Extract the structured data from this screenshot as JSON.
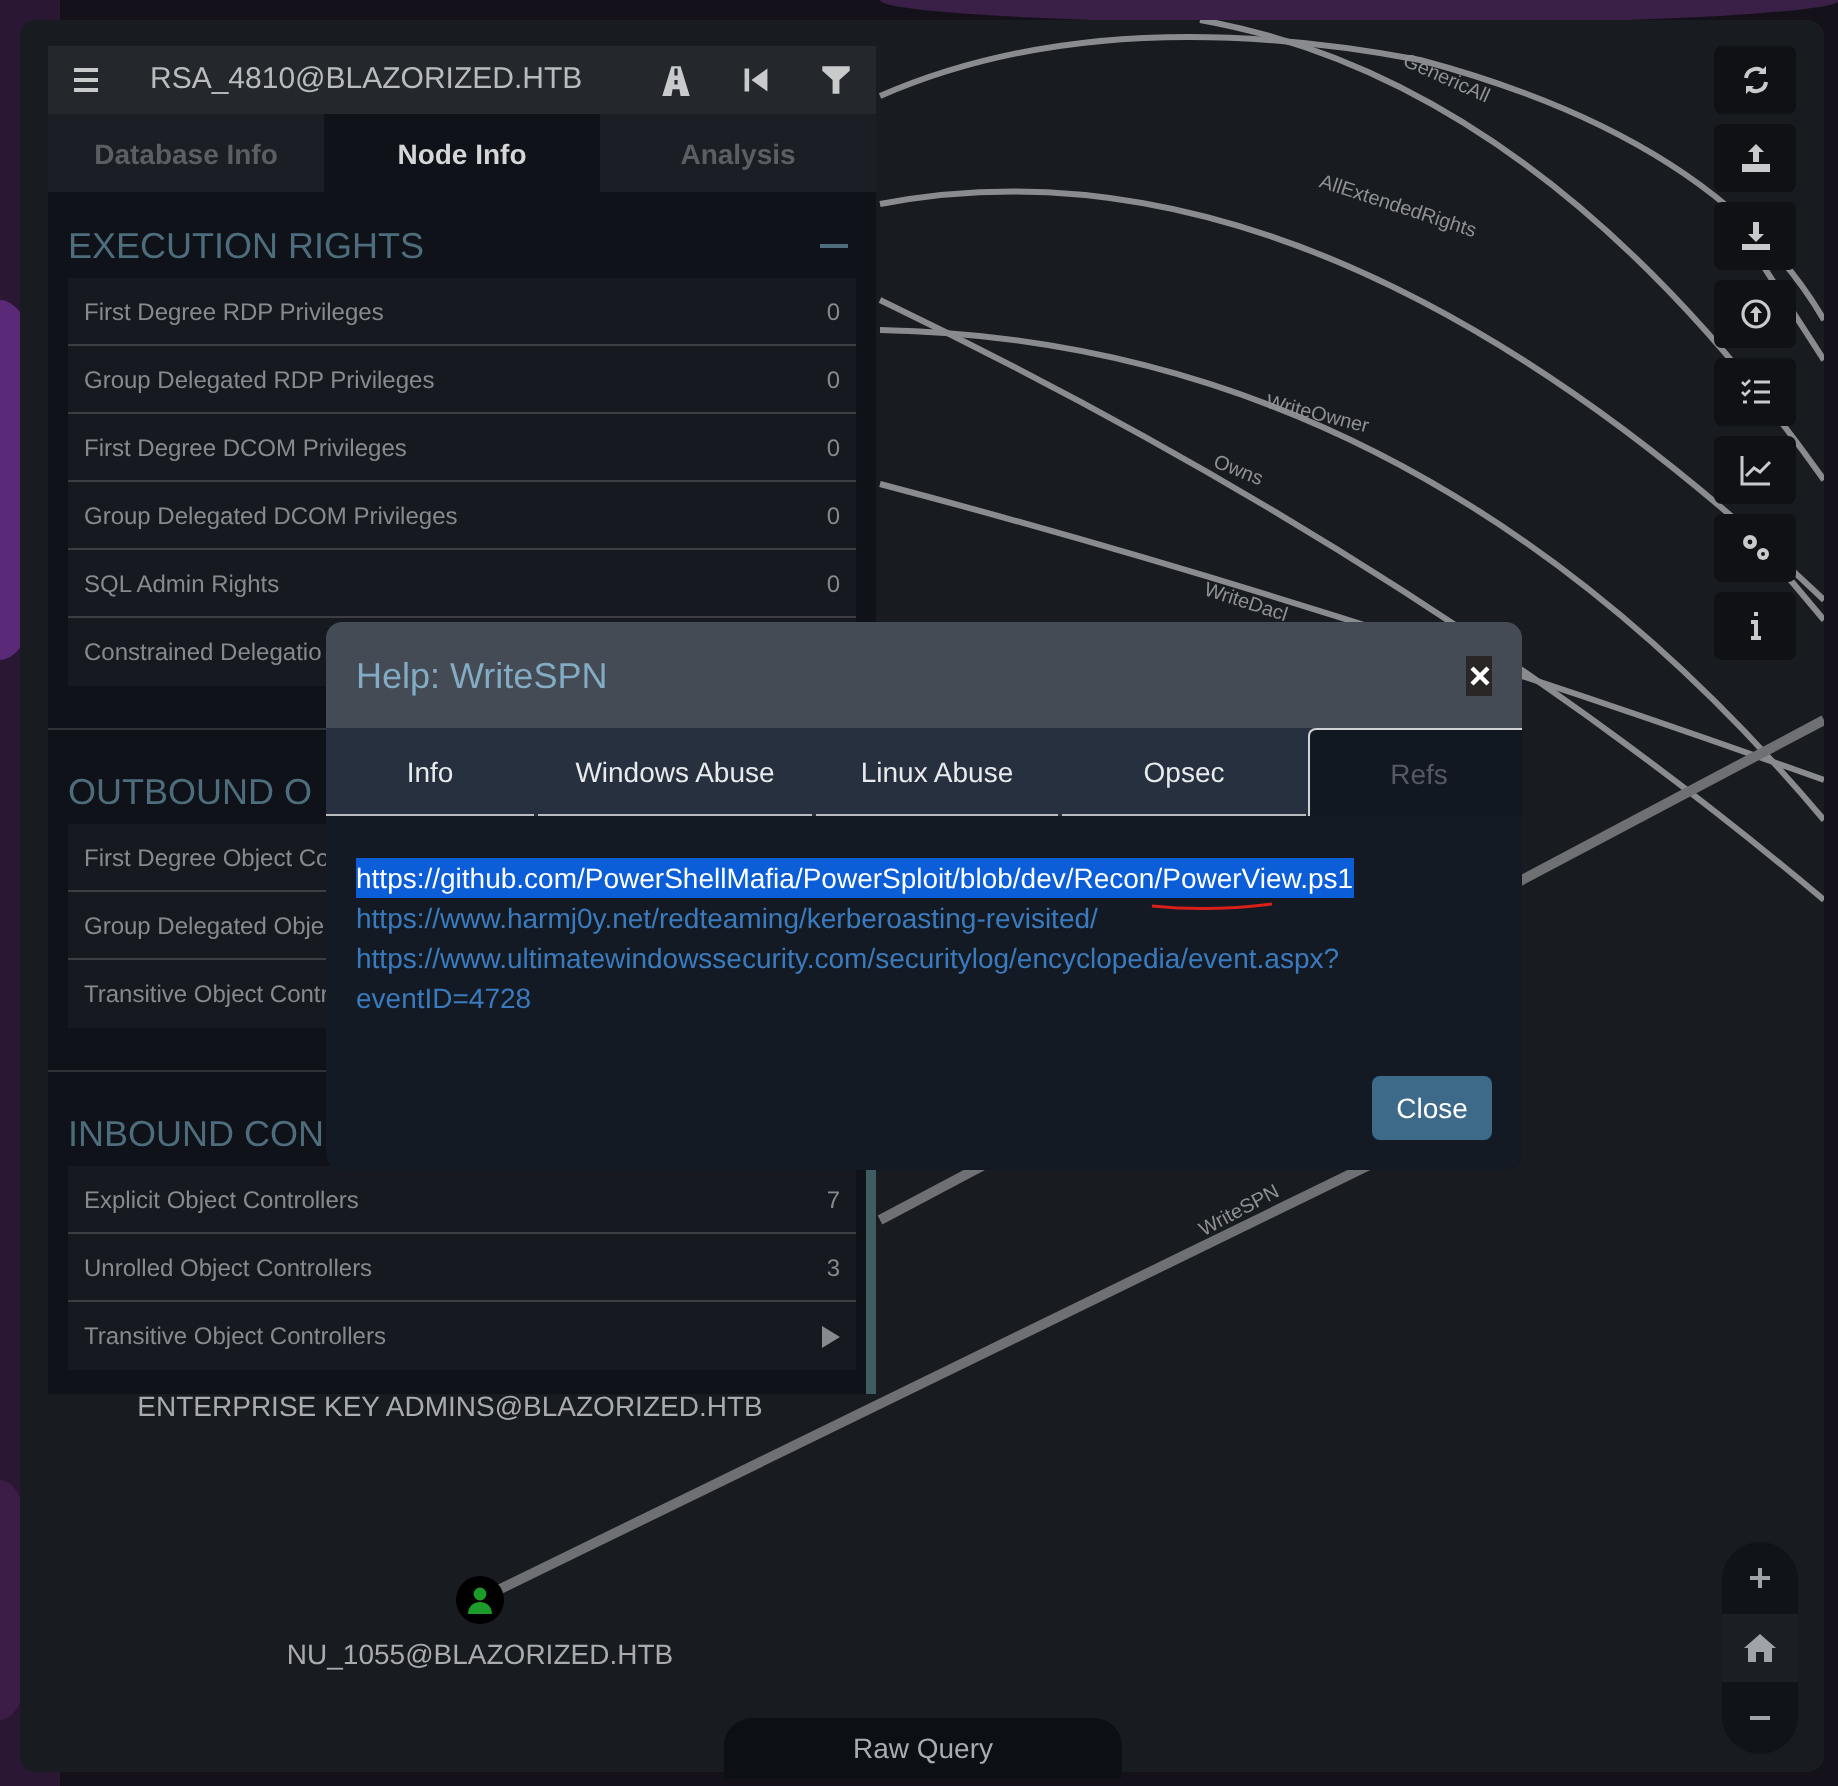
{
  "panel": {
    "title": "RSA_4810@BLAZORIZED.HTB",
    "tabs": [
      {
        "label": "Database Info",
        "selected": false
      },
      {
        "label": "Node Info",
        "selected": true
      },
      {
        "label": "Analysis",
        "selected": false
      }
    ],
    "sections": [
      {
        "title": "EXECUTION RIGHTS",
        "expanded": true,
        "rows": [
          {
            "label": "First Degree RDP Privileges",
            "value": "0"
          },
          {
            "label": "Group Delegated RDP Privileges",
            "value": "0"
          },
          {
            "label": "First Degree DCOM Privileges",
            "value": "0"
          },
          {
            "label": "Group Delegated DCOM Privileges",
            "value": "0"
          },
          {
            "label": "SQL Admin Rights",
            "value": "0"
          },
          {
            "label": "Constrained Delegatio"
          }
        ]
      },
      {
        "title": "OUTBOUND O",
        "rows": [
          {
            "label": "First Degree Object Co"
          },
          {
            "label": "Group Delegated Obje"
          },
          {
            "label": "Transitive Object Contr"
          }
        ]
      },
      {
        "title": "INBOUND CON",
        "rows": [
          {
            "label": "Explicit Object Controllers",
            "value": "7"
          },
          {
            "label": "Unrolled Object Controllers",
            "value": "3"
          },
          {
            "label": "Transitive Object Controllers",
            "kind": "expand"
          }
        ]
      }
    ]
  },
  "graph": {
    "edge_labels": [
      "GenericAll",
      "AllExtendedRights",
      "WriteOwner",
      "Owns",
      "WriteDacl",
      "WriteSPN"
    ],
    "nodes": [
      {
        "label": "ENTERPRISE KEY ADMINS@BLAZORIZED.HTB"
      },
      {
        "label": "NU_1055@BLAZORIZED.HTB",
        "kind": "user"
      }
    ]
  },
  "modal": {
    "title": "Help: WriteSPN",
    "tabs": [
      {
        "label": "Info",
        "selected": false
      },
      {
        "label": "Windows Abuse",
        "selected": false
      },
      {
        "label": "Linux Abuse",
        "selected": false
      },
      {
        "label": "Opsec",
        "selected": false
      },
      {
        "label": "Refs",
        "selected": true
      }
    ],
    "links": [
      {
        "text": "https://github.com/PowerShellMafia/PowerSploit/blob/dev/Recon/PowerView.ps1",
        "selected": true
      },
      {
        "text": "https://www.harmj0y.net/redteaming/kerberoasting-revisited/",
        "selected": false
      },
      {
        "text": "https://www.ultimatewindowssecurity.com/securitylog/encyclopedia/event.aspx?eventID=4728",
        "selected": false
      }
    ],
    "button": "Close"
  },
  "raw_query": "Raw Query"
}
